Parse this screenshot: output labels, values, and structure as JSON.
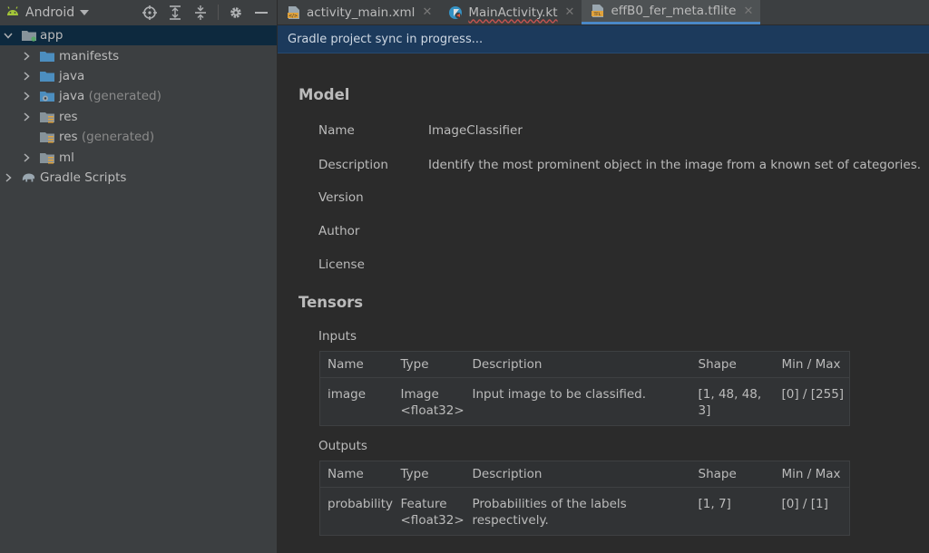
{
  "project_panel": {
    "view_label": "Android",
    "tree": [
      {
        "label": "app",
        "suffix": "",
        "expanded": true
      },
      {
        "label": "manifests",
        "suffix": ""
      },
      {
        "label": "java",
        "suffix": ""
      },
      {
        "label": "java",
        "suffix": " (generated)"
      },
      {
        "label": "res",
        "suffix": ""
      },
      {
        "label": "res",
        "suffix": " (generated)"
      },
      {
        "label": "ml",
        "suffix": ""
      },
      {
        "label": "Gradle Scripts",
        "suffix": ""
      }
    ]
  },
  "tabs": [
    {
      "label": "activity_main.xml",
      "icon": "xml-file-icon"
    },
    {
      "label": "MainActivity.kt",
      "icon": "kotlin-file-icon"
    },
    {
      "label": "effB0_fer_meta.tflite",
      "icon": "tflite-file-icon",
      "active": true
    }
  ],
  "banner": {
    "text": "Gradle project sync in progress..."
  },
  "model": {
    "heading": "Model",
    "fields": [
      {
        "key": "Name",
        "value": "ImageClassifier"
      },
      {
        "key": "Description",
        "value": "Identify the most prominent object in the image from a known set of categories."
      },
      {
        "key": "Version",
        "value": ""
      },
      {
        "key": "Author",
        "value": ""
      },
      {
        "key": "License",
        "value": ""
      }
    ]
  },
  "tensors": {
    "heading": "Tensors",
    "inputs_label": "Inputs",
    "outputs_label": "Outputs",
    "columns": [
      "Name",
      "Type",
      "Description",
      "Shape",
      "Min / Max"
    ],
    "inputs": [
      {
        "name": "image",
        "type_line1": "Image",
        "type_line2": "<float32>",
        "description": "Input image to be classified.",
        "shape": "[1, 48, 48, 3]",
        "minmax": "[0] / [255]"
      }
    ],
    "outputs": [
      {
        "name": "probability",
        "type_line1": "Feature",
        "type_line2": "<float32>",
        "description": "Probabilities of the labels respectively.",
        "shape": "[1, 7]",
        "minmax": "[0] / [1]"
      }
    ]
  },
  "colors": {
    "background": "#2b2b2b",
    "panel": "#3c3f41",
    "banner": "#1c3a5c",
    "accent_tab": "#4a88c7",
    "folder_blue": "#4c8ebf",
    "android_green": "#a4c639"
  }
}
